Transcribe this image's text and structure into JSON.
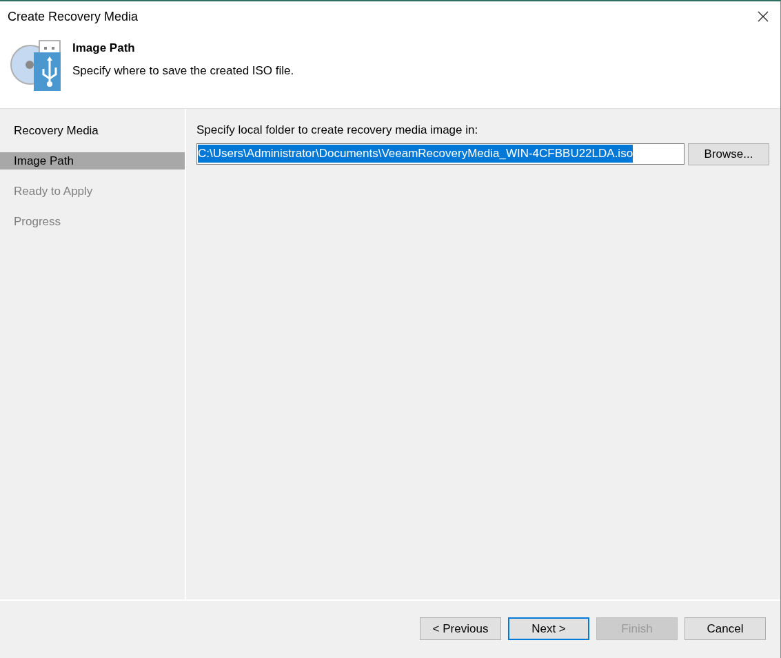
{
  "window": {
    "title": "Create Recovery Media"
  },
  "header": {
    "title": "Image Path",
    "subtitle": "Specify where to save the created ISO file."
  },
  "steps": [
    {
      "label": "Recovery Media",
      "selected": false,
      "disabled": false
    },
    {
      "label": "Image Path",
      "selected": true,
      "disabled": false
    },
    {
      "label": "Ready to Apply",
      "selected": false,
      "disabled": true
    },
    {
      "label": "Progress",
      "selected": false,
      "disabled": true
    }
  ],
  "folder": {
    "label": "Specify local folder to create recovery media image in:",
    "value": "C:\\Users\\Administrator\\Documents\\VeeamRecoveryMedia_WIN-4CFBBU22LDA.iso",
    "selected": true,
    "browse_button": "Browse..."
  },
  "buttons": [
    {
      "label": "< Previous",
      "disabled": false,
      "focused": false
    },
    {
      "label": "Next >",
      "disabled": false,
      "focused": true
    },
    {
      "label": "Finish",
      "disabled": true,
      "focused": false
    },
    {
      "label": "Cancel",
      "disabled": false,
      "focused": false
    }
  ]
}
